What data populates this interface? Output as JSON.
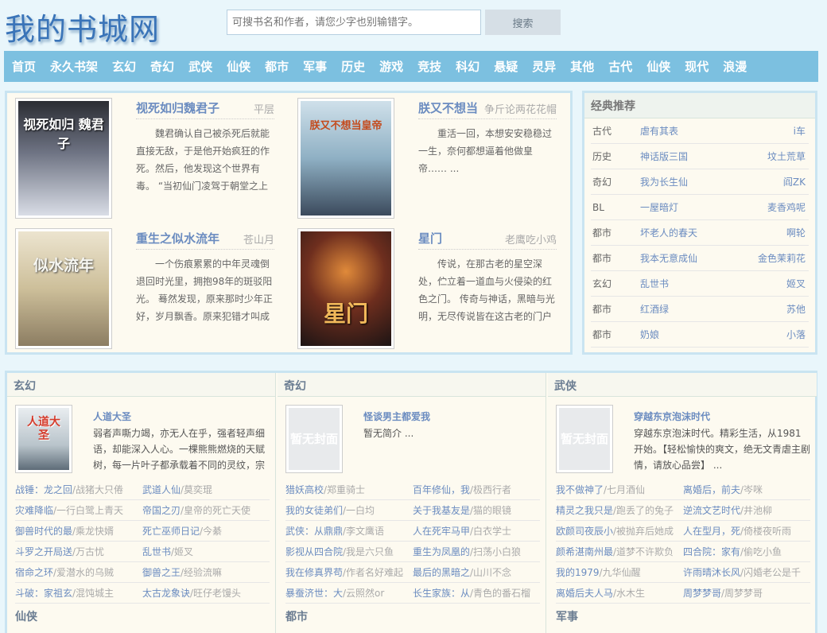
{
  "site": {
    "logo": "我的书城网"
  },
  "search": {
    "placeholder": "可搜书名和作者，请您少字也别输错字。",
    "button": "搜索"
  },
  "nav": [
    "首页",
    "永久书架",
    "玄幻",
    "奇幻",
    "武侠",
    "仙侠",
    "都市",
    "军事",
    "历史",
    "游戏",
    "竞技",
    "科幻",
    "悬疑",
    "灵异",
    "其他",
    "古代",
    "仙侠",
    "现代",
    "浪漫"
  ],
  "featured": [
    {
      "title": "视死如归魏君子",
      "author": "平层",
      "cover_text": "视死如归 魏君子",
      "desc": "魏君确认自己被杀死后就能直接无敌，于是他开始疯狂的作死。然后，他发现这个世界有毒。 “当初仙门凌驾于朝堂之上作威作"
    },
    {
      "title": "朕又不想当",
      "author": "争斤论两花花帽",
      "cover_text": "朕又不想当皇帝",
      "desc": "重活一回，本想安安稳稳过一生，奈何都想逼着他做皇帝……  ..."
    },
    {
      "title": "重生之似水流年",
      "author": "苍山月",
      "cover_text": "似水流年",
      "desc": "一个伤痕累累的中年灵魂倒退回时光里，拥抱98年的斑驳阳光。 蓦然发现，原来那时少年正好，岁月飘香。原来犯错才叫成"
    },
    {
      "title": "星门",
      "author": "老鹰吃小鸡",
      "cover_text": "星门",
      "desc": "传说，在那古老的星空深处，伫立着一道血与火侵染的红色之门。 传奇与神话，黑暗与光明，无尽传说皆在这古老的门户中流"
    }
  ],
  "recommend": {
    "header": "经典推荐",
    "items": [
      {
        "cat": "古代",
        "name": "虐有其表",
        "author": "i车"
      },
      {
        "cat": "历史",
        "name": "神话版三国",
        "author": "坟土荒草"
      },
      {
        "cat": "奇幻",
        "name": "我为长生仙",
        "author": "阎ZK"
      },
      {
        "cat": "BL",
        "name": "一屋暗灯",
        "author": "麦香鸡呢"
      },
      {
        "cat": "都市",
        "name": "坏老人的春天",
        "author": "啊轮"
      },
      {
        "cat": "都市",
        "name": "我本无意成仙",
        "author": "金色茉莉花"
      },
      {
        "cat": "玄幻",
        "name": "乱世书",
        "author": "姬叉"
      },
      {
        "cat": "都市",
        "name": "红酒绿",
        "author": "苏他"
      },
      {
        "cat": "都市",
        "name": "奶娘",
        "author": "小落"
      }
    ]
  },
  "sections": [
    {
      "header": "玄幻",
      "feature": {
        "title": "人道大圣",
        "cover_text": "人道大圣",
        "desc": "弱者声嘶力竭，亦无人在乎，强者轻声细语，却能深入人心。一棵熊熊燃烧的天赋树，每一片叶子都承载着不同的灵纹，宗"
      },
      "list": [
        [
          "战锤：龙之回",
          "/战猪大只倦",
          "武道人仙",
          "/莫奕琨"
        ],
        [
          "灾难降临",
          "/一行白鹭上青天",
          "帝国之刃",
          "/皇帝的死亡天使"
        ],
        [
          "御兽时代的最",
          "/乘龙快婿",
          "死亡巫师日记",
          "/今綦"
        ],
        [
          "斗罗之开局送",
          "/万古忧",
          "乱世书",
          "/姬叉"
        ],
        [
          "宿命之环",
          "/爱潜水的乌贼",
          "御兽之王",
          "/经验流嘛"
        ],
        [
          "斗破：家祖玄",
          "/混饨城主",
          "太古龙象诀",
          "/旺仔老馒头"
        ]
      ],
      "next": "仙侠"
    },
    {
      "header": "奇幻",
      "feature": {
        "title": "怪谈男主都爱我",
        "cover_text": "暂无封面",
        "desc": "暂无简介 ..."
      },
      "list": [
        [
          "猎妖高校",
          "/郑重骑士",
          "百年修仙，我",
          "/极西行者"
        ],
        [
          "我的女徒弟们",
          "/一白均",
          "关于我基友是",
          "/猫的眼镜"
        ],
        [
          "武侠：从鼎鼎",
          "/李文鹰语",
          "人在死牢马甲",
          "/白衣学士"
        ],
        [
          "影视从四合院",
          "/我是六只鱼",
          "重生为凤凰的",
          "/扫荡小白狼"
        ],
        [
          "我在修真界苟",
          "/作者名好难起",
          "最后的黑暗之",
          "/山川不念"
        ],
        [
          "暴蚕济世：大",
          "/云照然or",
          "长生家族：从",
          "/青色的番石榴"
        ]
      ],
      "next": "都市"
    },
    {
      "header": "武侠",
      "feature": {
        "title": "穿越东京泡沫时代",
        "cover_text": "暂无封面",
        "desc": "穿越东京泡沫时代。精彩生活，从1981开始。【轻松愉快的爽文，绝无文青虐主剧情，请放心品尝】 ..."
      },
      "list": [
        [
          "我不做神了",
          "/七月酒仙",
          "离婚后，前夫",
          "/岑咪"
        ],
        [
          "精灵之我只是",
          "/跑丢了的兔子",
          "逆流文艺时代",
          "/井池柳"
        ],
        [
          "欧颜司夜辰小",
          "/被抛弃后她成",
          "人在型月，死",
          "/倚楼夜听雨"
        ],
        [
          "颜希湛南州最",
          "/道梦不许欺负",
          "四合院：家有",
          "/偷吃小鱼"
        ],
        [
          "我的1979",
          "/九华仙醒",
          "许雨晴沐长风",
          "/闪婚老公是千"
        ],
        [
          "离婚后夫人马",
          "/水木生",
          "周梦梦哥",
          "/周梦梦哥"
        ]
      ],
      "next": "军事"
    }
  ]
}
